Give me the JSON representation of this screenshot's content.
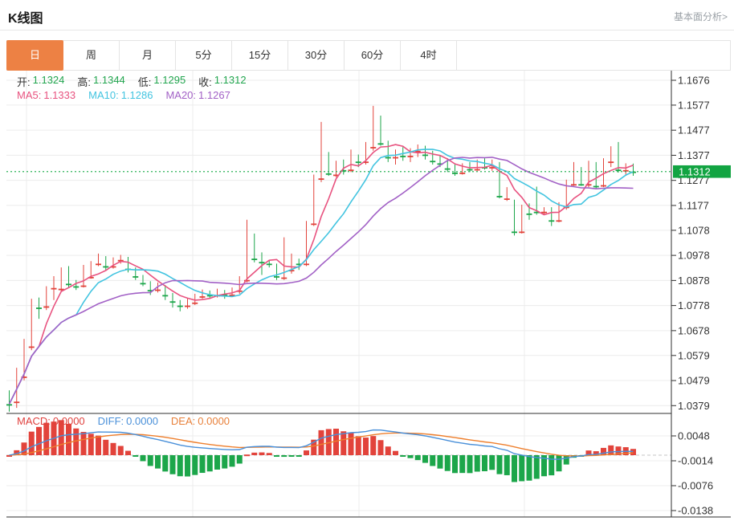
{
  "header": {
    "title": "K线图",
    "link": "基本面分析>"
  },
  "tabs": {
    "items": [
      "日",
      "周",
      "月",
      "5分",
      "15分",
      "30分",
      "60分",
      "4时"
    ],
    "active_index": 0,
    "active_color": "#ED8144"
  },
  "ohlc_legend": {
    "value_color": "#21A54E",
    "items": [
      {
        "label": "开:",
        "value": "1.1324"
      },
      {
        "label": "高:",
        "value": "1.1344"
      },
      {
        "label": "低:",
        "value": "1.1295"
      },
      {
        "label": "收:",
        "value": "1.1312"
      }
    ]
  },
  "ma_legend": {
    "items": [
      {
        "label": "MA5:",
        "value": "1.1333",
        "color": "#E8527F"
      },
      {
        "label": "MA10:",
        "value": "1.1286",
        "color": "#42C4E0"
      },
      {
        "label": "MA20:",
        "value": "1.1267",
        "color": "#A261C6"
      }
    ]
  },
  "macd_legend": {
    "items": [
      {
        "label": "MACD:",
        "value": "0.0000",
        "color": "#E0403D"
      },
      {
        "label": "DIFF:",
        "value": "0.0000",
        "color": "#4A90D9"
      },
      {
        "label": "DEA:",
        "value": "0.0000",
        "color": "#E8803A"
      }
    ]
  },
  "chart_data": {
    "type": "candlestick",
    "title": "K线图 (daily candlestick with MA5/MA10/MA20 and MACD panel)",
    "ylim": [
      1.0379,
      1.1676
    ],
    "y_ticks": [
      "1.1676",
      "1.1577",
      "1.1477",
      "1.1377",
      "1.1277",
      "1.1177",
      "1.1078",
      "1.0978",
      "1.0878",
      "1.0778",
      "1.0678",
      "1.0579",
      "1.0479",
      "1.0379"
    ],
    "current_price": 1.1312,
    "current_price_label": "1.1312",
    "ma_periods": [
      5,
      10,
      20
    ],
    "macd": {
      "params": [
        12,
        26,
        9
      ],
      "y_ticks": [
        "0.0048",
        "-0.0014",
        "-0.0076",
        "-0.0138"
      ]
    },
    "colors": {
      "up": "#E2433B",
      "down": "#1CA64A",
      "ma": [
        "#E8527F",
        "#42C4E0",
        "#A261C6"
      ],
      "diff_line": "#4A90D9",
      "dea_line": "#EE7F2D",
      "current_line": "#2BB257",
      "price_tag_bg": "#12A442",
      "grid": "#ececec",
      "axis": "#2f2f2f",
      "macd_zero_dash": "#c4c4c4"
    },
    "ohlc": [
      [
        1.041,
        1.044,
        1.0355,
        1.0385
      ],
      [
        1.0395,
        1.053,
        1.037,
        1.0505
      ],
      [
        1.0495,
        1.0645,
        1.048,
        1.0625
      ],
      [
        1.0615,
        1.0805,
        1.06,
        1.079
      ],
      [
        1.0795,
        1.081,
        1.0725,
        1.077
      ],
      [
        1.0775,
        1.0855,
        1.076,
        1.084
      ],
      [
        1.0848,
        1.0895,
        1.08,
        1.0852
      ],
      [
        1.0845,
        1.093,
        1.0835,
        1.092
      ],
      [
        1.0925,
        1.0935,
        1.085,
        1.0865
      ],
      [
        1.0868,
        1.088,
        1.084,
        1.0855
      ],
      [
        1.0858,
        1.094,
        1.085,
        1.089
      ],
      [
        1.0892,
        1.0955,
        1.0885,
        1.0942
      ],
      [
        1.0945,
        1.0985,
        1.0935,
        1.0968
      ],
      [
        1.0968,
        1.0975,
        1.092,
        1.0935
      ],
      [
        1.0935,
        1.097,
        1.0925,
        1.0958
      ],
      [
        1.096,
        1.098,
        1.0945,
        1.0968
      ],
      [
        1.0968,
        1.0972,
        1.091,
        1.0925
      ],
      [
        1.0925,
        1.093,
        1.088,
        1.0895
      ],
      [
        1.0895,
        1.09,
        1.0855,
        1.0868
      ],
      [
        1.0868,
        1.0875,
        1.082,
        1.084
      ],
      [
        1.0842,
        1.087,
        1.083,
        1.0855
      ],
      [
        1.0855,
        1.086,
        1.08,
        1.082
      ],
      [
        1.082,
        1.0828,
        1.077,
        1.0795
      ],
      [
        1.0795,
        1.08,
        1.0755,
        1.0778
      ],
      [
        1.0778,
        1.0805,
        1.0765,
        1.079
      ],
      [
        1.079,
        1.0825,
        1.078,
        1.0815
      ],
      [
        1.0815,
        1.0842,
        1.0805,
        1.083
      ],
      [
        1.083,
        1.0838,
        1.0808,
        1.082
      ],
      [
        1.082,
        1.0845,
        1.081,
        1.0832
      ],
      [
        1.0832,
        1.084,
        1.0805,
        1.0822
      ],
      [
        1.0822,
        1.085,
        1.0812,
        1.0838
      ],
      [
        1.0838,
        1.0895,
        1.0825,
        1.088
      ],
      [
        1.088,
        1.112,
        1.087,
        1.105
      ],
      [
        1.1055,
        1.1065,
        1.095,
        1.0965
      ],
      [
        1.0965,
        1.099,
        1.09,
        1.0952
      ],
      [
        1.0952,
        1.096,
        1.093,
        1.0945
      ],
      [
        1.094,
        1.0945,
        1.088,
        1.0895
      ],
      [
        1.089,
        1.105,
        1.088,
        1.092
      ],
      [
        1.092,
        1.0985,
        1.0905,
        1.095
      ],
      [
        1.095,
        1.0965,
        1.092,
        1.0945
      ],
      [
        1.0945,
        1.1115,
        1.0935,
        1.1105
      ],
      [
        1.1105,
        1.13,
        1.1095,
        1.1285
      ],
      [
        1.1285,
        1.151,
        1.127,
        1.138
      ],
      [
        1.138,
        1.139,
        1.1295,
        1.1305
      ],
      [
        1.13,
        1.1355,
        1.129,
        1.134
      ],
      [
        1.1345,
        1.136,
        1.13,
        1.1318
      ],
      [
        1.132,
        1.14,
        1.131,
        1.136
      ],
      [
        1.136,
        1.138,
        1.133,
        1.1352
      ],
      [
        1.1352,
        1.143,
        1.134,
        1.1408
      ],
      [
        1.141,
        1.1574,
        1.1395,
        1.1505
      ],
      [
        1.151,
        1.1535,
        1.1415,
        1.1425
      ],
      [
        1.142,
        1.1435,
        1.135,
        1.137
      ],
      [
        1.137,
        1.14,
        1.134,
        1.139
      ],
      [
        1.139,
        1.141,
        1.1355,
        1.1375
      ],
      [
        1.1375,
        1.1405,
        1.135,
        1.1395
      ],
      [
        1.1395,
        1.142,
        1.137,
        1.1405
      ],
      [
        1.1405,
        1.1415,
        1.136,
        1.138
      ],
      [
        1.138,
        1.1395,
        1.134,
        1.1355
      ],
      [
        1.1355,
        1.1375,
        1.133,
        1.1345
      ],
      [
        1.1345,
        1.1365,
        1.131,
        1.1325
      ],
      [
        1.1325,
        1.134,
        1.1295,
        1.1308
      ],
      [
        1.1308,
        1.1345,
        1.13,
        1.1335
      ],
      [
        1.1335,
        1.135,
        1.131,
        1.1322
      ],
      [
        1.1322,
        1.136,
        1.1315,
        1.135
      ],
      [
        1.135,
        1.1365,
        1.132,
        1.133
      ],
      [
        1.133,
        1.136,
        1.1315,
        1.1348
      ],
      [
        1.1345,
        1.135,
        1.1205,
        1.1215
      ],
      [
        1.1205,
        1.125,
        1.1195,
        1.124
      ],
      [
        1.1185,
        1.12,
        1.1057,
        1.1073
      ],
      [
        1.1073,
        1.118,
        1.1065,
        1.117
      ],
      [
        1.117,
        1.1185,
        1.112,
        1.1145
      ],
      [
        1.1178,
        1.1252,
        1.114,
        1.1152
      ],
      [
        1.1152,
        1.117,
        1.114,
        1.116
      ],
      [
        1.116,
        1.117,
        1.1095,
        1.1118
      ],
      [
        1.1118,
        1.119,
        1.111,
        1.1175
      ],
      [
        1.1172,
        1.128,
        1.116,
        1.1262
      ],
      [
        1.1262,
        1.135,
        1.1255,
        1.131
      ],
      [
        1.1315,
        1.133,
        1.1255,
        1.1262
      ],
      [
        1.1262,
        1.1355,
        1.125,
        1.134
      ],
      [
        1.1338,
        1.135,
        1.1245,
        1.1255
      ],
      [
        1.1258,
        1.1365,
        1.125,
        1.1352
      ],
      [
        1.1352,
        1.1413,
        1.133,
        1.1372
      ],
      [
        1.1372,
        1.143,
        1.1308,
        1.132
      ],
      [
        1.1318,
        1.1345,
        1.13,
        1.1332
      ],
      [
        1.1324,
        1.1344,
        1.1295,
        1.1312
      ]
    ]
  }
}
